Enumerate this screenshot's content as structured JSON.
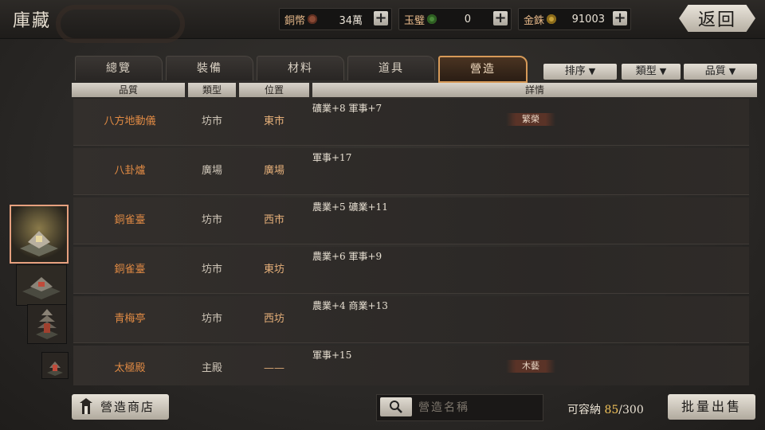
{
  "header": {
    "title": "庫藏",
    "back_label": "返回"
  },
  "currencies": [
    {
      "label": "銅幣",
      "value": "34萬",
      "coin_color": "#8a4a35"
    },
    {
      "label": "玉璧",
      "value": "0",
      "coin_color": "#4a8a3a"
    },
    {
      "label": "金銖",
      "value": "91003",
      "coin_color": "#c8a23a"
    }
  ],
  "tabs": [
    {
      "label": "總覽"
    },
    {
      "label": "裝備"
    },
    {
      "label": "材料"
    },
    {
      "label": "道具"
    },
    {
      "label": "營造",
      "active": true
    }
  ],
  "filters": {
    "sort": "排序",
    "type": "類型",
    "quality": "品質",
    "arrow": "▼"
  },
  "columns": {
    "quality": "品質",
    "type": "類型",
    "location": "位置",
    "details": "詳情"
  },
  "rows": [
    {
      "name": "八方地動儀",
      "type": "坊市",
      "location": "東市",
      "details": "礦業+8  軍事+7",
      "badge": "繁榮"
    },
    {
      "name": "八卦爐",
      "type": "廣場",
      "location": "廣場",
      "details": "軍事+17",
      "badge": ""
    },
    {
      "name": "銅雀臺",
      "type": "坊市",
      "location": "西市",
      "details": "農業+5  礦業+11",
      "badge": ""
    },
    {
      "name": "銅雀臺",
      "type": "坊市",
      "location": "東坊",
      "details": "農業+6  軍事+9",
      "badge": ""
    },
    {
      "name": "青梅亭",
      "type": "坊市",
      "location": "西坊",
      "details": "農業+4  商業+13",
      "badge": ""
    },
    {
      "name": "太極殿",
      "type": "主殿",
      "location": "——",
      "details": "軍事+15",
      "badge": "木藝"
    }
  ],
  "bottom": {
    "shop_label": "營造商店",
    "search_placeholder": "營造名稱",
    "capacity_label": "可容納",
    "capacity_count": "85",
    "capacity_max": "/300",
    "sell_label": "批量出售"
  },
  "colors": {
    "accent": "#d79a58",
    "name": "#e08a44",
    "count": "#f2c35a"
  }
}
